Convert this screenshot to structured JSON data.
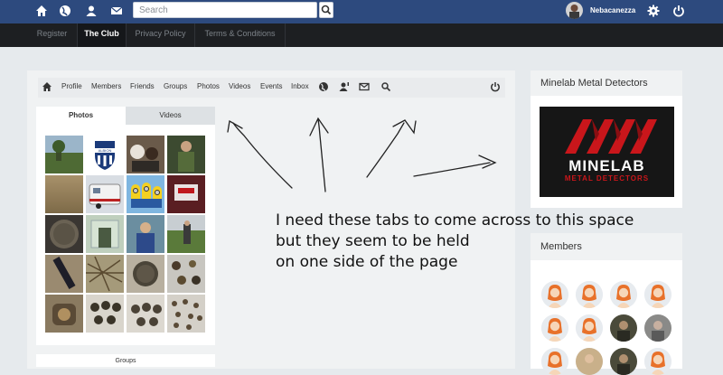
{
  "topbar": {
    "icons": [
      "home-icon",
      "globe-icon",
      "user-icon",
      "mail-icon"
    ],
    "search_placeholder": "Search",
    "username": "Nebacanezza",
    "right_icons": [
      "gear-icon",
      "power-icon"
    ]
  },
  "subnav": {
    "items": [
      "Register",
      "The Club",
      "Privacy Policy",
      "Terms & Conditions"
    ],
    "active": "The Club"
  },
  "profile_nav": {
    "items": [
      "Profile",
      "Members",
      "Friends",
      "Groups",
      "Photos",
      "Videos",
      "Events",
      "Inbox"
    ],
    "icons": [
      "home-icon",
      "globe-icon",
      "user-alert-icon",
      "mail-icon",
      "search-icon",
      "power-icon"
    ]
  },
  "media_tabs": {
    "photos_label": "Photos",
    "videos_label": "Videos"
  },
  "groups_label": "Groups",
  "sidebar": {
    "ad_title": "Minelab Metal Detectors",
    "ad_brand": "MINELAB",
    "ad_sub": "METAL DETECTORS",
    "members_title": "Members"
  },
  "photo_thumbnails": [
    "Landscape with trees",
    "Albion crest",
    "Animals with people",
    "Person outdoors",
    "Dry field",
    "Caravan",
    "Minion figures",
    "Red bag",
    "Round coin",
    "Building doorway",
    "Person in blue",
    "Person in field",
    "Dark object",
    "Twigs",
    "Corroded coin",
    "Coins on table",
    "Jar of coins",
    "Row of coins",
    "Scattered coins",
    "Coins and tags"
  ],
  "annotation": {
    "line1": "I need these tabs to come across to this space",
    "line2": "but they seem to be held",
    "line3": "on one side of the page"
  },
  "colors": {
    "topbar_bg": "#2d4a7e",
    "subbar_bg": "#1d1f22",
    "page_bg": "#e6eaed",
    "ad_red": "#c9161b"
  }
}
